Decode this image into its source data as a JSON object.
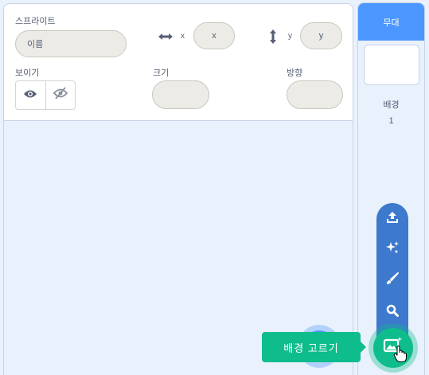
{
  "sprite_info": {
    "sprite_label": "스프라이트",
    "name_placeholder": "이름",
    "x_label": "x",
    "x_placeholder": "x",
    "y_label": "y",
    "y_placeholder": "y",
    "show_label": "보이기",
    "size_label": "크기",
    "direction_label": "방향"
  },
  "stage": {
    "header_label": "무대",
    "backdrops_label": "배경",
    "backdrop_count": "1"
  },
  "backdrop_menu": {
    "items": [
      "upload-icon",
      "surprise-icon",
      "paint-icon",
      "search-icon"
    ],
    "main_button_icon": "backdrop-picker-icon",
    "tooltip": "배경 고르기"
  },
  "colors": {
    "stage_header": "#4c97ff",
    "menu": "#3d79cc",
    "choose_button": "#0fbd8c",
    "text": "#575e75"
  }
}
